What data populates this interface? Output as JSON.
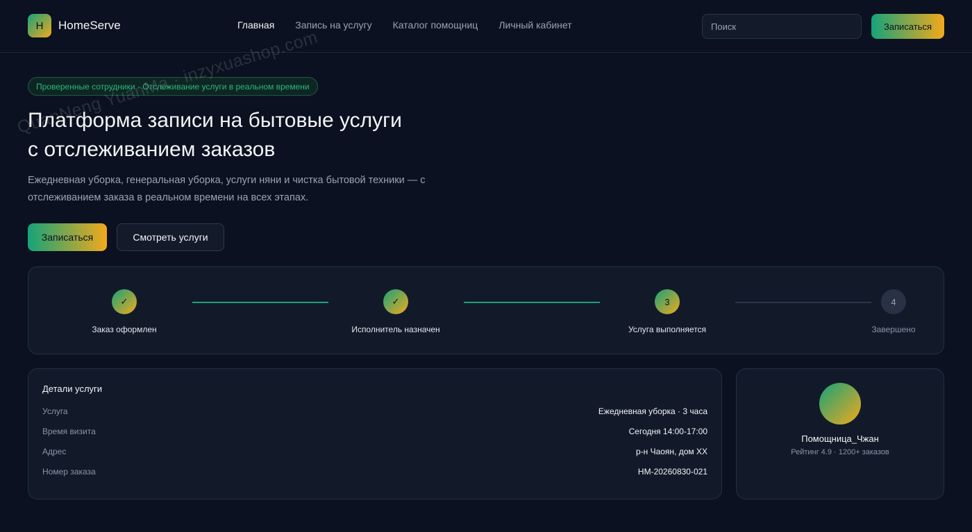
{
  "header": {
    "logo_letter": "H",
    "brand": "HomeServe",
    "nav": [
      "Главная",
      "Запись на услугу",
      "Каталог помощниц",
      "Личный кабинет"
    ],
    "search_placeholder": "Поиск",
    "cta": "Записаться"
  },
  "hero": {
    "badge": "Проверенные сотрудники · Отслеживание услуги в реальном времени",
    "title_line1": "Платформа записи на бытовые услуги",
    "title_line2": "с отслеживанием заказов",
    "subtitle_line1": "Ежедневная уборка, генеральная уборка, услуги няни и чистка бытовой техники — с",
    "subtitle_line2": "отслеживанием заказа в реальном времени на всех этапах.",
    "primary_button": "Записаться",
    "secondary_button": "Смотреть услуги"
  },
  "tracker": {
    "steps": [
      {
        "marker": "✓",
        "label": "Заказ оформлен",
        "status": "done"
      },
      {
        "marker": "✓",
        "label": "Исполнитель назначен",
        "status": "done"
      },
      {
        "marker": "3",
        "label": "Услуга выполняется",
        "status": "active"
      },
      {
        "marker": "4",
        "label": "Завершено",
        "status": "pending"
      }
    ]
  },
  "details": {
    "title": "Детали услуги",
    "rows": [
      {
        "key": "Услуга",
        "value": "Ежедневная уборка · 3 часа"
      },
      {
        "key": "Время визита",
        "value": "Сегодня 14:00-17:00"
      },
      {
        "key": "Адрес",
        "value": "р-н Чаоян, дом XX"
      },
      {
        "key": "Номер заказа",
        "value": "HM-20260830-021"
      }
    ]
  },
  "helper": {
    "name": "Помощница_Чжан",
    "meta": "Рейтинг 4.9 · 1200+ заказов"
  },
  "watermark": "QuanNeng YuanMa · inzyxuashop.com",
  "colors": {
    "background": "#0b1120",
    "card": "#121a2a",
    "accent_green": "#16a37a",
    "accent_amber": "#f2a91c",
    "text_muted": "#9ca3af"
  }
}
